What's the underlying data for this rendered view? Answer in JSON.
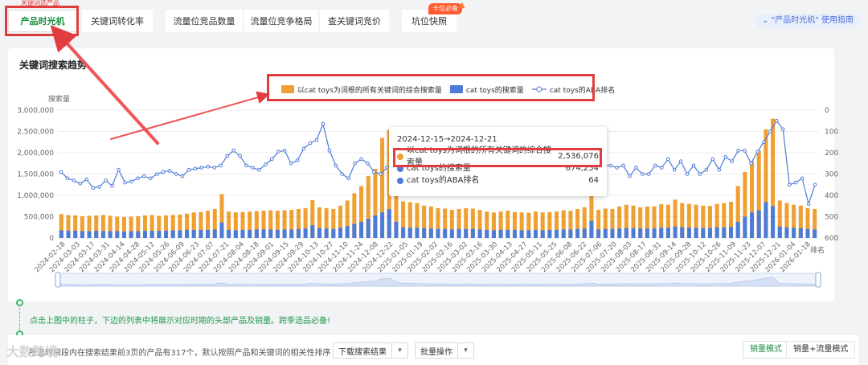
{
  "tabs": [
    {
      "label": "产品时光机",
      "active": true
    },
    {
      "label": "关键词转化率",
      "active": false
    },
    {
      "label": "流量位竞品数量",
      "active": false
    },
    {
      "label": "流量位竞争格局",
      "active": false
    },
    {
      "label": "查关键词竞价",
      "active": false
    },
    {
      "label": "坑位快照",
      "active": false
    }
  ],
  "tab_top_tag": "关键词选产品",
  "hot_badge": "卡位必备",
  "guide_link": "\"产品时光机\" 使用指南",
  "panel_title": "关键词搜索趋势",
  "tooltip": {
    "date": "2024-12-15→2024-12-21",
    "rows": [
      {
        "label": "以cat toys为词根的所有关键词的综合搜索量",
        "value": "2,536,076",
        "color": "#f0a032"
      },
      {
        "label": "cat toys的搜索量",
        "value": "674,254",
        "color": "#4d7bd8"
      },
      {
        "label": "cat toys的ABA排名",
        "value": "64",
        "color": "#4d7bd8"
      }
    ]
  },
  "hint": "点击上图中的柱子，下边的列表中将展示对应时期的头部产品及销量。跨季选品必备!",
  "bottom": {
    "desc": "所选时间段内在搜索结果前3页的产品有317个，默认按照产品和关键词的相关性排序",
    "download": "下载搜索结果",
    "batch": "批量操作",
    "mode_sales": "销量模式",
    "mode_sales_traffic": "销量+流量模式"
  },
  "watermark": "大数跨境",
  "chart_data": {
    "type": "bar",
    "ylabel": "搜索量",
    "y2label": "排名",
    "ylim": [
      0,
      3000000
    ],
    "y2lim": [
      600,
      0
    ],
    "yticks": [
      "3,000,000",
      "2,500,000",
      "2,000,000",
      "1,500,000",
      "1,000,000",
      "500,000",
      "0"
    ],
    "y2ticks": [
      "0",
      "100",
      "200",
      "300",
      "400",
      "500",
      "600"
    ],
    "legend_position": "top-center",
    "x_tick_labels": [
      "2024-02-18",
      "2024-03-03",
      "2024-03-17",
      "2024-03-31",
      "2024-04-14",
      "2024-04-28",
      "2024-05-12",
      "2024-05-26",
      "2024-06-09",
      "2024-06-23",
      "2024-07-07",
      "2024-07-21",
      "2024-08-04",
      "2024-08-18",
      "2024-09-01",
      "2024-09-15",
      "2024-09-29",
      "2024-10-13",
      "2024-10-27",
      "2024-11-10",
      "2024-11-24",
      "2024-12-08",
      "2024-12-22",
      "2025-01-05",
      "2025-01-19",
      "2025-02-02",
      "2025-02-16",
      "2025-03-02",
      "2025-03-16",
      "2025-03-30",
      "2025-04-13",
      "2025-04-27",
      "2025-05-11",
      "2025-05-25",
      "2025-06-08",
      "2025-06-22",
      "2025-07-06",
      "2025-07-20",
      "2025-08-03",
      "2025-08-17",
      "2025-08-31",
      "2025-09-14",
      "2025-09-28",
      "2025-10-12",
      "2025-10-26",
      "2025-11-09",
      "2025-11-23",
      "2025-12-07",
      "2025-12-21",
      "2026-01-04",
      "2026-01-18"
    ],
    "series": [
      {
        "name": "以cat toys为词根的所有关键词的综合搜索量",
        "kind": "bar",
        "color": "#f0a032",
        "values": [
          560000,
          540000,
          530000,
          510000,
          520000,
          530000,
          540000,
          520000,
          500000,
          490000,
          500000,
          510000,
          530000,
          540000,
          520000,
          530000,
          540000,
          550000,
          570000,
          600000,
          610000,
          640000,
          680000,
          1030000,
          620000,
          600000,
          610000,
          620000,
          630000,
          640000,
          650000,
          640000,
          650000,
          660000,
          680000,
          700000,
          890000,
          720000,
          700000,
          680000,
          760000,
          880000,
          1050000,
          1220000,
          1450000,
          1620000,
          2350000,
          2536076,
          1350000,
          860000,
          840000,
          820000,
          760000,
          740000,
          700000,
          690000,
          660000,
          680000,
          700000,
          690000,
          660000,
          620000,
          600000,
          620000,
          640000,
          610000,
          600000,
          590000,
          620000,
          600000,
          610000,
          620000,
          650000,
          640000,
          680000,
          720000,
          1000000,
          660000,
          690000,
          680000,
          740000,
          780000,
          760000,
          720000,
          740000,
          740000,
          790000,
          780000,
          900000,
          820000,
          800000,
          780000,
          760000,
          750000,
          800000,
          820000,
          850000,
          1220000,
          1550000,
          1800000,
          2050000,
          2550000,
          2800000,
          880000,
          820000,
          780000,
          760000,
          700000,
          680000
        ],
        "values2": [
          180000,
          170000,
          170000,
          160000,
          160000,
          170000,
          160000,
          160000,
          160000,
          150000,
          160000,
          160000,
          170000,
          170000,
          170000,
          170000,
          180000,
          180000,
          190000,
          190000,
          190000,
          190000,
          200000,
          360000,
          190000,
          180000,
          190000,
          190000,
          200000,
          200000,
          200000,
          190000,
          200000,
          200000,
          210000,
          220000,
          300000,
          230000,
          220000,
          210000,
          240000,
          280000,
          330000,
          380000,
          450000,
          530000,
          600000,
          674254,
          380000,
          250000,
          240000,
          240000,
          230000,
          220000,
          210000,
          210000,
          200000,
          210000,
          210000,
          210000,
          200000,
          190000,
          180000,
          190000,
          190000,
          190000,
          180000,
          180000,
          190000,
          180000,
          190000,
          190000,
          200000,
          200000,
          210000,
          220000,
          400000,
          200000,
          210000,
          210000,
          220000,
          230000,
          230000,
          220000,
          220000,
          220000,
          240000,
          240000,
          270000,
          250000,
          240000,
          240000,
          230000,
          230000,
          250000,
          250000,
          260000,
          380000,
          500000,
          600000,
          650000,
          840000,
          750000,
          270000,
          250000,
          240000,
          230000,
          210000,
          200000
        ]
      },
      {
        "name": "cat toys的搜索量",
        "kind": "bar",
        "color": "#4d7bd8"
      },
      {
        "name": "cat toys的ABA排名",
        "kind": "line",
        "color": "#4d7bd8",
        "values": [
          290,
          320,
          330,
          345,
          325,
          365,
          360,
          330,
          355,
          280,
          340,
          335,
          320,
          310,
          320,
          300,
          290,
          285,
          300,
          310,
          280,
          275,
          270,
          265,
          270,
          260,
          215,
          190,
          215,
          260,
          270,
          280,
          255,
          230,
          195,
          190,
          250,
          235,
          180,
          155,
          140,
          64,
          190,
          260,
          300,
          320,
          250,
          230,
          250,
          290,
          300,
          270,
          260,
          280,
          270,
          290,
          300,
          260,
          270,
          290,
          280,
          290,
          300,
          260,
          260,
          250,
          270,
          250,
          300,
          270,
          300,
          290,
          260,
          250,
          250,
          290,
          270,
          300,
          250,
          310,
          280,
          270,
          290,
          300,
          300,
          260,
          260,
          270,
          260,
          310,
          270,
          300,
          300,
          260,
          270,
          230,
          280,
          240,
          300,
          260,
          300,
          280,
          230,
          280,
          220,
          240,
          190,
          190,
          250,
          195,
          150,
          100,
          50,
          90,
          350,
          340,
          320,
          440,
          350
        ]
      }
    ]
  }
}
